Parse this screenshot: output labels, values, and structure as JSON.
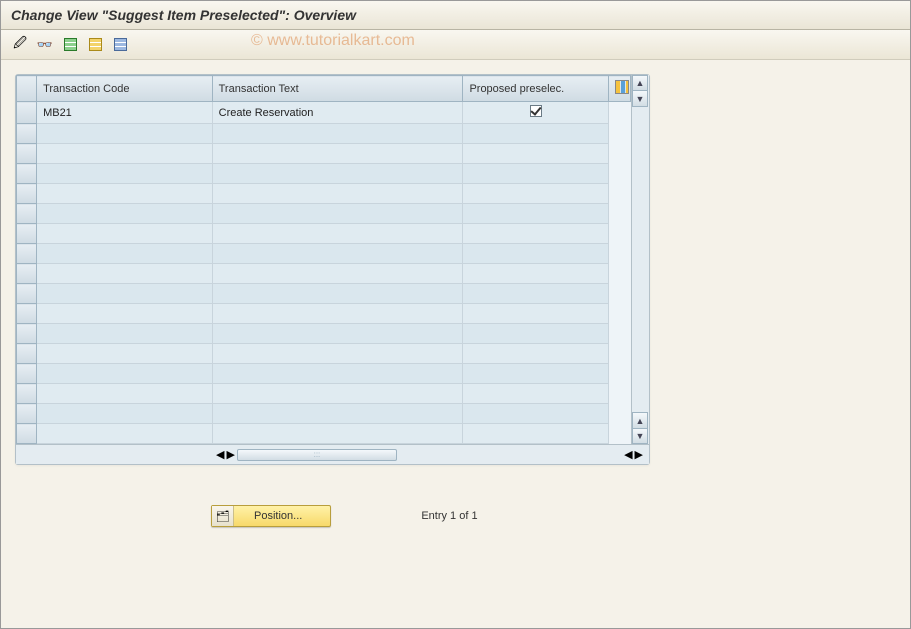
{
  "title": "Change View \"Suggest Item Preselected\": Overview",
  "watermark": "© www.tutorialkart.com",
  "toolbar": {
    "change_display_tooltip": "Display/Change",
    "other_entry_tooltip": "Other Entry",
    "new_entries_tooltip": "New Entries",
    "copy_tooltip": "Copy As",
    "delete_tooltip": "Delete"
  },
  "grid": {
    "columns": {
      "transaction_code": "Transaction Code",
      "transaction_text": "Transaction Text",
      "proposed_preselec": "Proposed preselec."
    },
    "rows": [
      {
        "tcode": "MB21",
        "text": "Create Reservation",
        "preselected": true
      }
    ],
    "empty_row_count": 16
  },
  "footer": {
    "position_label": "Position...",
    "entry_text": "Entry 1 of 1"
  }
}
